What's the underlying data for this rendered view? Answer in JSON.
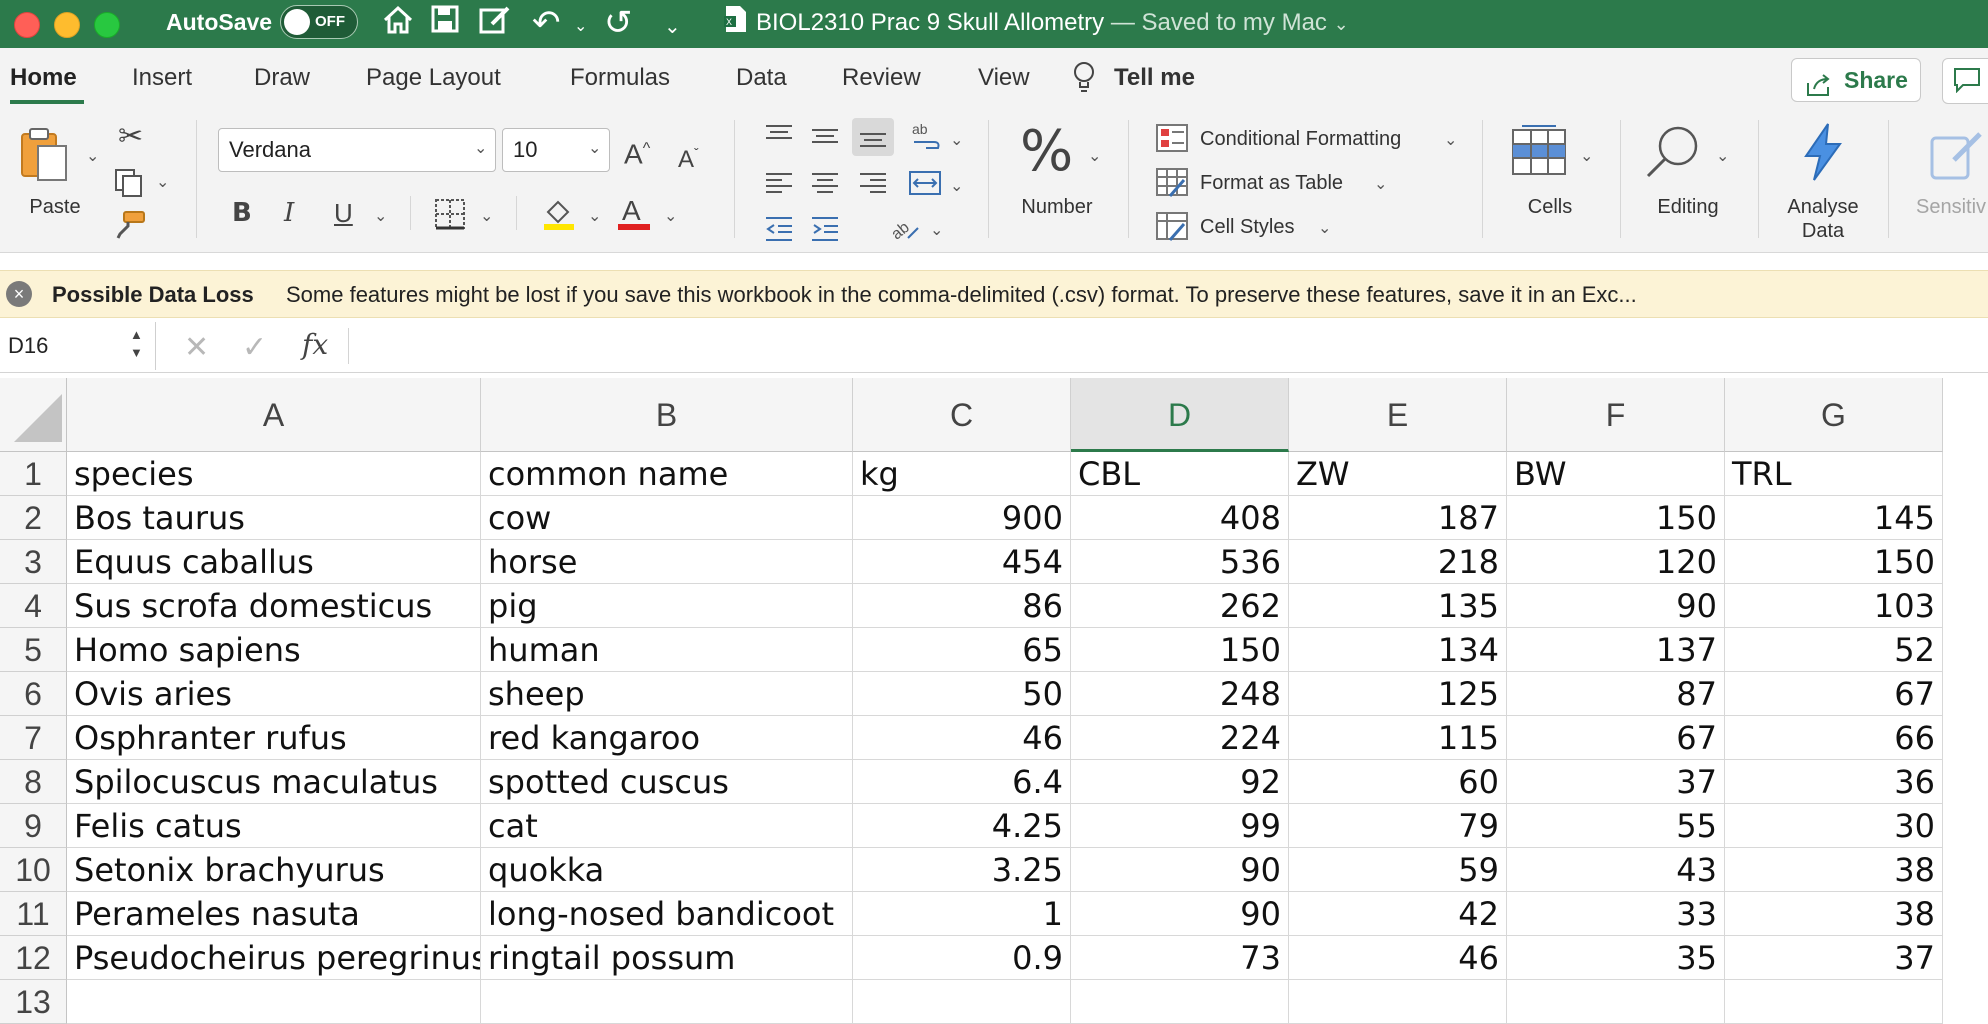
{
  "titlebar": {
    "autosave_label": "AutoSave",
    "autosave_state": "OFF",
    "doc_name": "BIOL2310 Prac 9 Skull Allometry",
    "doc_status": " — Saved to my Mac ",
    "doc_status_chevron": "⌄"
  },
  "tabs": [
    "Home",
    "Insert",
    "Draw",
    "Page Layout",
    "Formulas",
    "Data",
    "Review",
    "View"
  ],
  "tell_me": "Tell me",
  "share_label": "Share",
  "ribbon": {
    "paste_label": "Paste",
    "font_name": "Verdana",
    "font_size": "10",
    "bold": "B",
    "italic": "I",
    "underline": "U",
    "font_color_glyph": "A",
    "grow_font": "A",
    "shrink_font": "A",
    "number_label": "Number",
    "number_glyph": "%",
    "conditional_formatting": "Conditional Formatting",
    "format_as_table": "Format as Table",
    "cell_styles": "Cell Styles",
    "cells_label": "Cells",
    "editing_label": "Editing",
    "analyse_label_1": "Analyse",
    "analyse_label_2": "Data",
    "sensitivity_label": "Sensitiv"
  },
  "message_bar": {
    "title": "Possible Data Loss",
    "text": "Some features might be lost if you save this workbook in the comma-delimited (.csv) format. To preserve these features, save it in an Exc..."
  },
  "formula_bar": {
    "name_box": "D16",
    "fx": "fx",
    "formula": ""
  },
  "grid": {
    "columns": [
      "A",
      "B",
      "C",
      "D",
      "E",
      "F",
      "G"
    ],
    "selected_column": "D",
    "row_numbers": [
      "1",
      "2",
      "3",
      "4",
      "5",
      "6",
      "7",
      "8",
      "9",
      "10",
      "11",
      "12",
      "13"
    ],
    "rows": [
      [
        "species",
        "common name",
        "kg",
        "CBL",
        "ZW",
        "BW",
        "TRL"
      ],
      [
        "Bos taurus",
        "cow",
        "900",
        "408",
        "187",
        "150",
        "145"
      ],
      [
        "Equus caballus",
        "horse",
        "454",
        "536",
        "218",
        "120",
        "150"
      ],
      [
        "Sus scrofa domesticus",
        "pig",
        "86",
        "262",
        "135",
        "90",
        "103"
      ],
      [
        "Homo sapiens",
        "human",
        "65",
        "150",
        "134",
        "137",
        "52"
      ],
      [
        "Ovis aries",
        "sheep",
        "50",
        "248",
        "125",
        "87",
        "67"
      ],
      [
        "Osphranter rufus",
        "red kangaroo",
        "46",
        "224",
        "115",
        "67",
        "66"
      ],
      [
        "Spilocuscus maculatus",
        "spotted cuscus",
        "6.4",
        "92",
        "60",
        "37",
        "36"
      ],
      [
        "Felis catus",
        "cat",
        "4.25",
        "99",
        "79",
        "55",
        "30"
      ],
      [
        "Setonix brachyurus",
        "quokka",
        "3.25",
        "90",
        "59",
        "43",
        "38"
      ],
      [
        "Perameles nasuta",
        "long-nosed bandicoot",
        "1",
        "90",
        "42",
        "33",
        "38"
      ],
      [
        "Pseudocheirus peregrinus",
        "ringtail possum",
        "0.9",
        "73",
        "46",
        "35",
        "37"
      ],
      [
        "",
        "",
        "",
        "",
        "",
        "",
        ""
      ]
    ]
  },
  "colors": {
    "accent": "#2c7a4b",
    "message_bg": "#fcf3d6"
  },
  "icons": [
    "home-icon",
    "save-icon",
    "edit-icon",
    "undo-icon",
    "redo-icon",
    "customize-icon",
    "excel-file-icon",
    "lightbulb-icon",
    "share-icon",
    "comment-icon",
    "paste-icon",
    "cut-icon",
    "copy-icon",
    "format-painter-icon",
    "borders-icon",
    "fill-color-icon",
    "font-color-icon",
    "align-icon",
    "wrap-text-icon",
    "merge-icon",
    "orientation-icon",
    "indent-icon",
    "conditional-formatting-icon",
    "format-as-table-icon",
    "cell-styles-icon",
    "cells-icon",
    "search-icon",
    "analyse-data-icon",
    "sensitivity-icon",
    "warning-close-icon",
    "cancel-icon",
    "enter-icon",
    "select-all-icon"
  ]
}
